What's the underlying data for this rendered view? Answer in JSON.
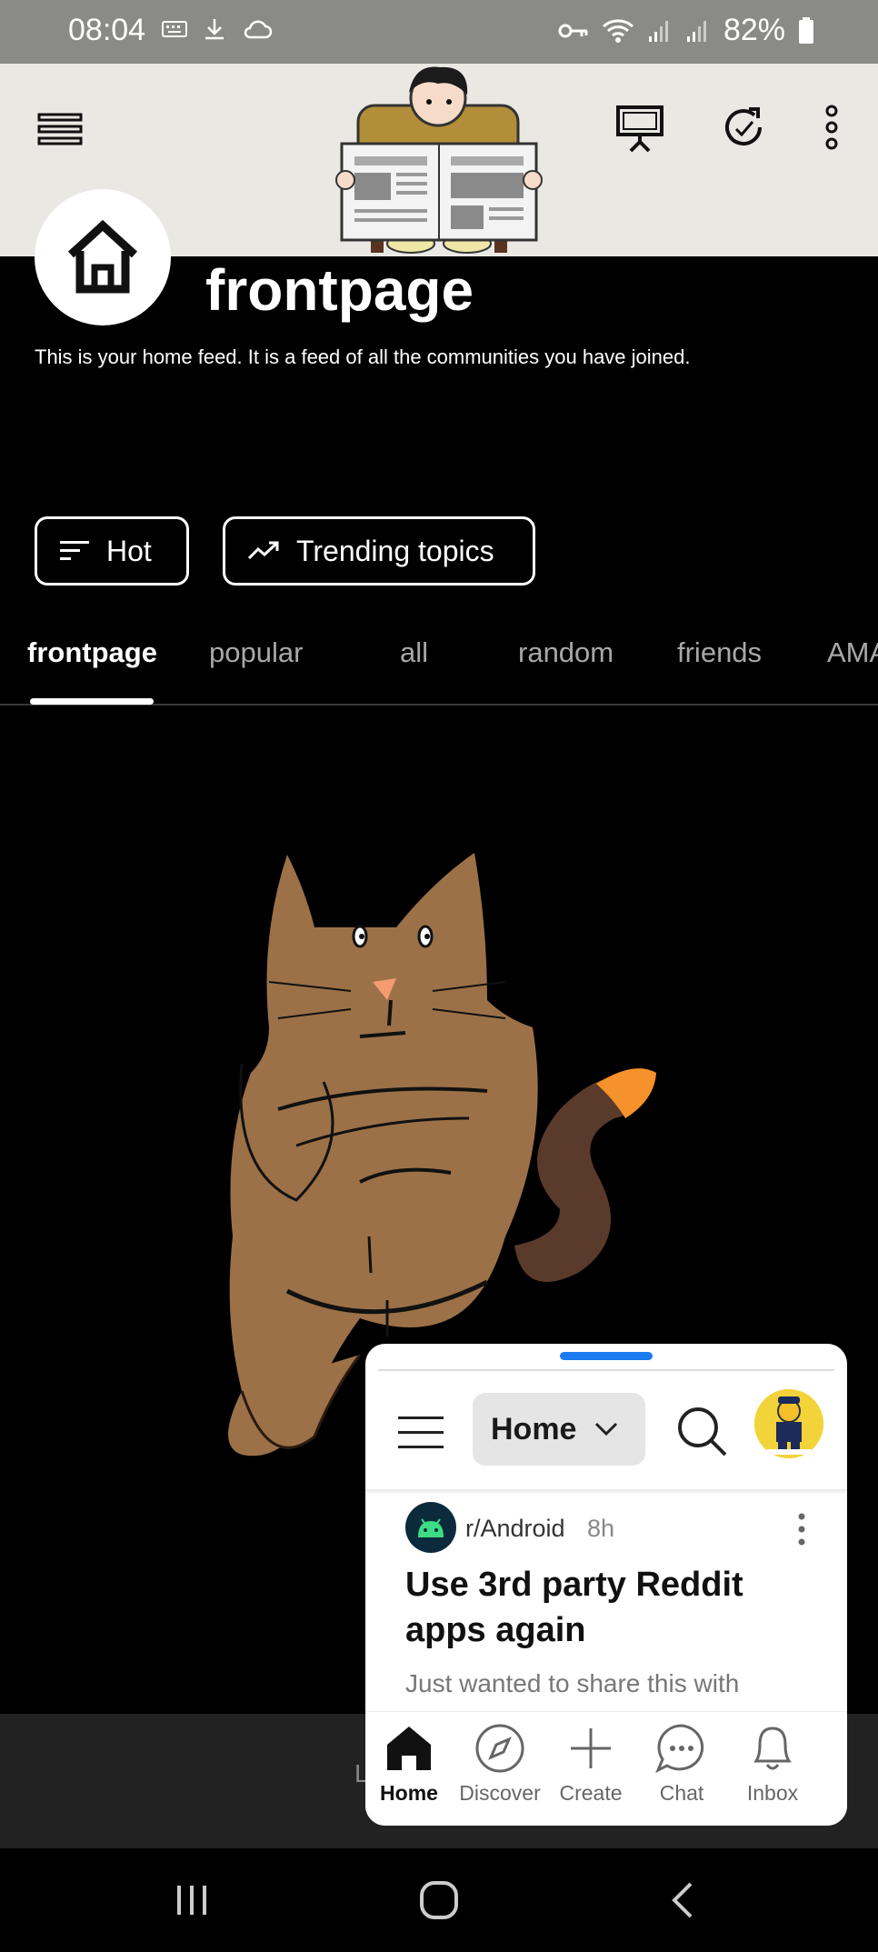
{
  "status_bar": {
    "time": "08:04",
    "battery": "82%"
  },
  "header": {
    "menu_icon": "menu-icon",
    "present_icon": "presentation-icon",
    "refresh_icon": "refresh-icon",
    "more_icon": "more-vertical-icon"
  },
  "community": {
    "title": "frontpage",
    "description": "This is your home feed. It is a feed of all the communities you have joined."
  },
  "sort": {
    "sort_label": "Hot",
    "trending_label": "Trending topics"
  },
  "tabs": [
    {
      "label": "frontpage",
      "active": true
    },
    {
      "label": "popular"
    },
    {
      "label": "all"
    },
    {
      "label": "random"
    },
    {
      "label": "friends"
    },
    {
      "label": "AMA"
    }
  ],
  "bottom_strip": {
    "partial_text": "L"
  },
  "pip": {
    "feed_selector": "Home",
    "post": {
      "subreddit": "r/Android",
      "age": "8h",
      "title": "Use 3rd party Reddit apps again",
      "body": "Just wanted to share this with"
    },
    "nav": [
      {
        "label": "Home",
        "icon": "home-icon",
        "active": true
      },
      {
        "label": "Discover",
        "icon": "compass-icon"
      },
      {
        "label": "Create",
        "icon": "plus-icon"
      },
      {
        "label": "Chat",
        "icon": "chat-icon"
      },
      {
        "label": "Inbox",
        "icon": "bell-icon"
      }
    ]
  },
  "colors": {
    "background": "#000000",
    "header_bg": "#e9e8e3",
    "status_bar_bg": "#8a8a86",
    "accent_blue": "#1d7bf2",
    "cat_brown": "#9c7148",
    "tail_orange": "#f5922b"
  }
}
